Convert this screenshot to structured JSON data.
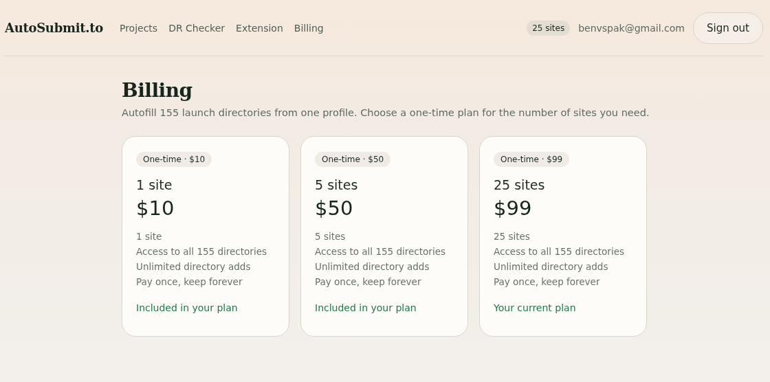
{
  "header": {
    "logo": "AutoSubmit.to",
    "nav": [
      "Projects",
      "DR Checker",
      "Extension",
      "Billing"
    ],
    "sites_badge": "25 sites",
    "email": "benvspak@gmail.com",
    "sign_out": "Sign out"
  },
  "page": {
    "title": "Billing",
    "subtitle": "Autofill 155 launch directories from one profile. Choose a one-time plan for the number of sites you need."
  },
  "plans": [
    {
      "tag": "One-time · $10",
      "name": "1 site",
      "price": "$10",
      "features": [
        "1 site",
        "Access to all 155 directories",
        "Unlimited directory adds",
        "Pay once, keep forever"
      ],
      "status": "Included in your plan"
    },
    {
      "tag": "One-time · $50",
      "name": "5 sites",
      "price": "$50",
      "features": [
        "5 sites",
        "Access to all 155 directories",
        "Unlimited directory adds",
        "Pay once, keep forever"
      ],
      "status": "Included in your plan"
    },
    {
      "tag": "One-time · $99",
      "name": "25 sites",
      "price": "$99",
      "features": [
        "25 sites",
        "Access to all 155 directories",
        "Unlimited directory adds",
        "Pay once, keep forever"
      ],
      "status": "Your current plan"
    }
  ]
}
